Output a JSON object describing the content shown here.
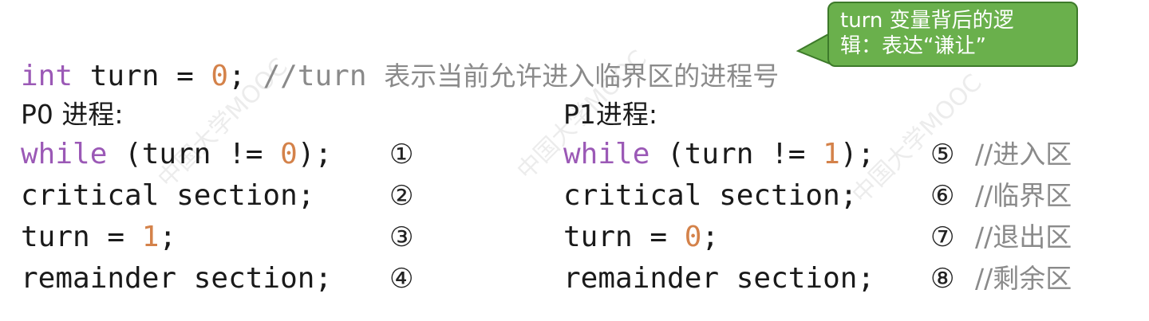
{
  "header": {
    "decl_kw": "int",
    "decl_var": " turn = ",
    "decl_val": "0",
    "decl_semi": ";",
    "comment_prefix": " //turn ",
    "comment_text": "表示当前允许进入临界区的进程号"
  },
  "callout": {
    "line1": "turn 变量背后的逻",
    "line2": "辑：表达“谦让”"
  },
  "p0": {
    "title": "P0 进程:",
    "line1_kw": "while",
    "line1_a": " (turn != ",
    "line1_val": "0",
    "line1_b": ");",
    "line2": "critical section;",
    "line3_a": "turn = ",
    "line3_val": "1",
    "line3_b": ";",
    "line4": "remainder section;",
    "marks": [
      "①",
      "②",
      "③",
      "④"
    ]
  },
  "p1": {
    "title": "P1进程:",
    "line1_kw": "while",
    "line1_a": " (turn != ",
    "line1_val": "1",
    "line1_b": ");",
    "line2": "critical section;",
    "line3_a": "turn = ",
    "line3_val": "0",
    "line3_b": ";",
    "line4": "remainder section;",
    "marks": [
      "⑤",
      "⑥",
      "⑦",
      "⑧"
    ],
    "notes": [
      "//进入区",
      "//临界区",
      "//退出区",
      "//剩余区"
    ]
  },
  "colors": {
    "keyword": "#9b59b6",
    "number": "#d4824a",
    "comment": "#8a8a8a",
    "callout_bg": "#6ab04c"
  },
  "watermark": "中国大学MOOC"
}
